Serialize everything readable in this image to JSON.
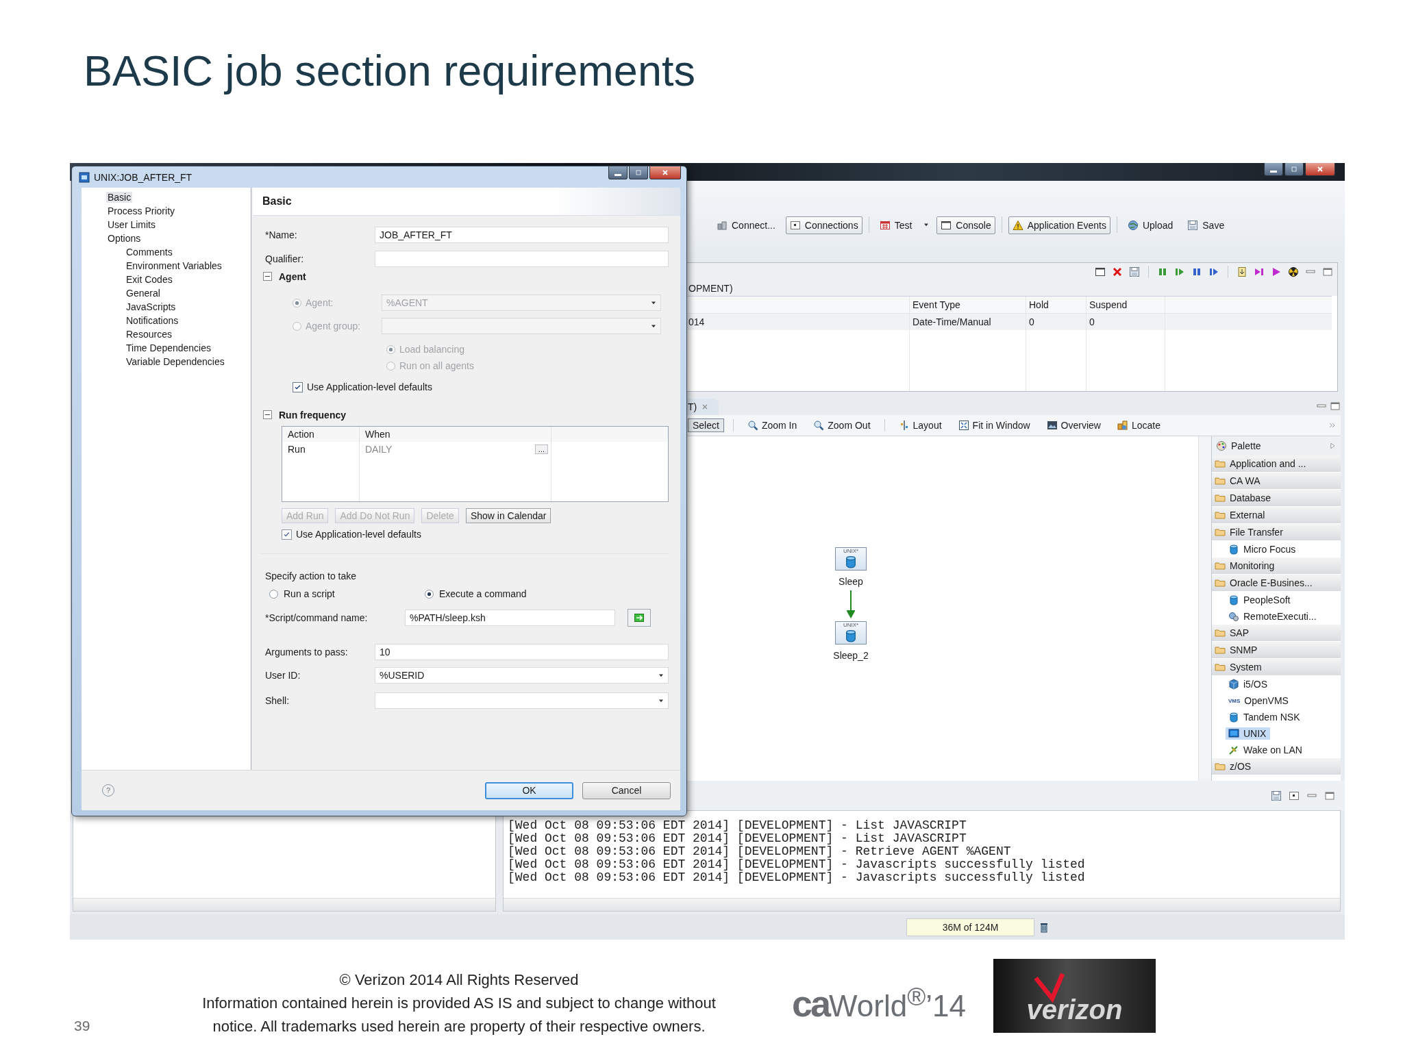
{
  "slide": {
    "title": "BASIC job section requirements",
    "page_number": "39",
    "footer_lines": [
      "© Verizon 2014 All Rights Reserved",
      "Information contained herein is provided AS IS and subject to change without",
      "notice.  All trademarks used herein are property of their respective owners."
    ],
    "logos": [
      {
        "kind": "ca_world",
        "mark": "ca",
        "text": "World$^{®}$’14"
      },
      {
        "kind": "verizon",
        "text": "verizon"
      }
    ]
  },
  "app": {
    "toolbar": [
      {
        "kind": "button",
        "label": "Connect...",
        "selected": false
      },
      {
        "kind": "button",
        "label": "Connections",
        "selected": true
      },
      {
        "kind": "button",
        "label": "Test",
        "selected": false
      },
      {
        "kind": "menu_arrow"
      },
      {
        "kind": "button",
        "label": "Console",
        "selected": true
      },
      {
        "kind": "button",
        "label": "Application Events",
        "selected": true
      },
      {
        "kind": "button",
        "label": "Upload",
        "selected": false
      },
      {
        "kind": "button",
        "label": "Save",
        "selected": false
      }
    ],
    "events": {
      "heading": "OPMENT)",
      "columns": [
        "",
        "Event Type",
        "Hold",
        "Suspend"
      ],
      "rows": [
        {
          "cells": [
            "014",
            "Date-Time/Manual",
            "0",
            "0"
          ]
        }
      ]
    },
    "graph": {
      "tab": "T)",
      "tools": [
        {
          "label": "Select",
          "selected": true
        },
        {
          "label": "Zoom In",
          "selected": false
        },
        {
          "label": "Zoom Out",
          "selected": false
        },
        {
          "label": "Layout",
          "selected": false
        },
        {
          "label": "Fit in Window",
          "selected": false
        },
        {
          "label": "Overview",
          "selected": false
        },
        {
          "label": "Locate",
          "selected": false
        }
      ],
      "nodes": [
        {
          "badge": "UNIX*",
          "label": "Sleep"
        },
        {
          "badge": "UNIX*",
          "label": "Sleep_2"
        }
      ],
      "palette": {
        "title": "Palette",
        "items": [
          {
            "kind": "folder",
            "label": "Application and ...",
            "selected": false
          },
          {
            "kind": "folder",
            "label": "CA WA",
            "selected": false
          },
          {
            "kind": "folder",
            "label": "Database",
            "selected": false
          },
          {
            "kind": "folder",
            "label": "External",
            "selected": false
          },
          {
            "kind": "folder",
            "label": "File Transfer",
            "selected": false,
            "children": [
              {
                "kind": "cylinder",
                "label": "Micro Focus",
                "selected": false
              }
            ]
          },
          {
            "kind": "folder",
            "label": "Monitoring",
            "selected": false
          },
          {
            "kind": "folder",
            "label": "Oracle E-Busines...",
            "selected": false,
            "children": [
              {
                "kind": "cylinder",
                "label": "PeopleSoft",
                "selected": false
              },
              {
                "kind": "remote",
                "label": "RemoteExecuti...",
                "selected": false
              }
            ]
          },
          {
            "kind": "folder",
            "label": "SAP",
            "selected": false
          },
          {
            "kind": "folder",
            "label": "SNMP",
            "selected": false
          },
          {
            "kind": "folder",
            "label": "System",
            "selected": false,
            "children": [
              {
                "kind": "cube",
                "label": "i5/OS",
                "selected": false
              },
              {
                "kind": "vms",
                "badge": "VMS",
                "label": "OpenVMS",
                "selected": false
              },
              {
                "kind": "cylinder",
                "label": "Tandem NSK",
                "selected": false
              },
              {
                "kind": "monitor",
                "label": "UNIX",
                "selected": true
              },
              {
                "kind": "network",
                "label": "Wake on LAN",
                "selected": false
              }
            ]
          },
          {
            "kind": "folder",
            "label": "z/OS",
            "selected": false
          }
        ]
      }
    },
    "console": {
      "lines": [
        "[Wed Oct 08 09:53:06 EDT 2014] [DEVELOPMENT] - List JAVASCRIPT",
        "[Wed Oct 08 09:53:06 EDT 2014] [DEVELOPMENT] - List JAVASCRIPT",
        "[Wed Oct 08 09:53:06 EDT 2014] [DEVELOPMENT] - Retrieve AGENT %AGENT",
        "[Wed Oct 08 09:53:06 EDT 2014] [DEVELOPMENT] - Javascripts successfully listed",
        "[Wed Oct 08 09:53:06 EDT 2014] [DEVELOPMENT] - Javascripts successfully listed"
      ],
      "memory": "36M of 124M"
    }
  },
  "dialog": {
    "title": "UNIX:JOB_AFTER_FT",
    "nav": [
      {
        "label": "Basic",
        "selected": true
      },
      {
        "label": "Process Priority",
        "selected": false
      },
      {
        "label": "User Limits",
        "selected": false
      },
      {
        "label": "Options",
        "selected": false,
        "children": [
          {
            "label": "Comments",
            "selected": false
          },
          {
            "label": "Environment Variables",
            "selected": false
          },
          {
            "label": "Exit Codes",
            "selected": false
          },
          {
            "label": "General",
            "selected": false
          },
          {
            "label": "JavaScripts",
            "selected": false
          },
          {
            "label": "Notifications",
            "selected": false
          },
          {
            "label": "Resources",
            "selected": false
          },
          {
            "label": "Time Dependencies",
            "selected": false
          },
          {
            "label": "Variable Dependencies",
            "selected": false
          }
        ]
      }
    ],
    "heading": "Basic",
    "fields": [
      {
        "label": "*Name:",
        "value": "JOB_AFTER_FT"
      },
      {
        "label": "Qualifier:"
      }
    ],
    "agent_section": {
      "title": "Agent",
      "expanded": true,
      "disabled": true,
      "options": [
        {
          "label": "Agent:",
          "selected": true,
          "value": "%AGENT"
        },
        {
          "label": "Agent group:",
          "selected": false
        }
      ],
      "distribution": [
        {
          "label": "Load balancing",
          "selected": true
        },
        {
          "label": "Run on all agents",
          "selected": false
        }
      ],
      "use_defaults": {
        "label": "Use Application-level defaults",
        "checked": true
      }
    },
    "run_frequency": {
      "title": "Run frequency",
      "expanded": true,
      "columns": [
        "Action",
        "When"
      ],
      "rows": [
        {
          "action": "Run",
          "when": "DAILY",
          "more": "..."
        }
      ],
      "buttons": [
        {
          "label": "Add Run",
          "disabled": true
        },
        {
          "label": "Add Do Not Run",
          "disabled": true
        },
        {
          "label": "Delete",
          "disabled": true
        },
        {
          "label": "Show in Calendar",
          "disabled": false
        }
      ],
      "use_defaults": {
        "label": "Use Application-level defaults",
        "checked": true
      }
    },
    "action": {
      "title": "Specify action to take",
      "options": [
        {
          "label": "Run a script",
          "selected": false
        },
        {
          "label": "Execute a command",
          "selected": true
        }
      ],
      "command": {
        "label": "*Script/command name:",
        "value": "%PATH/sleep.ksh"
      }
    },
    "more_fields": [
      {
        "kind": "text",
        "label": "Arguments to pass:",
        "value": "10"
      },
      {
        "kind": "combo",
        "label": "User ID:",
        "value": "%USERID"
      },
      {
        "kind": "combo",
        "label": "Shell:"
      }
    ],
    "help": "?",
    "buttons": [
      {
        "label": "OK",
        "default": true
      },
      {
        "label": "Cancel",
        "default": false
      }
    ]
  }
}
